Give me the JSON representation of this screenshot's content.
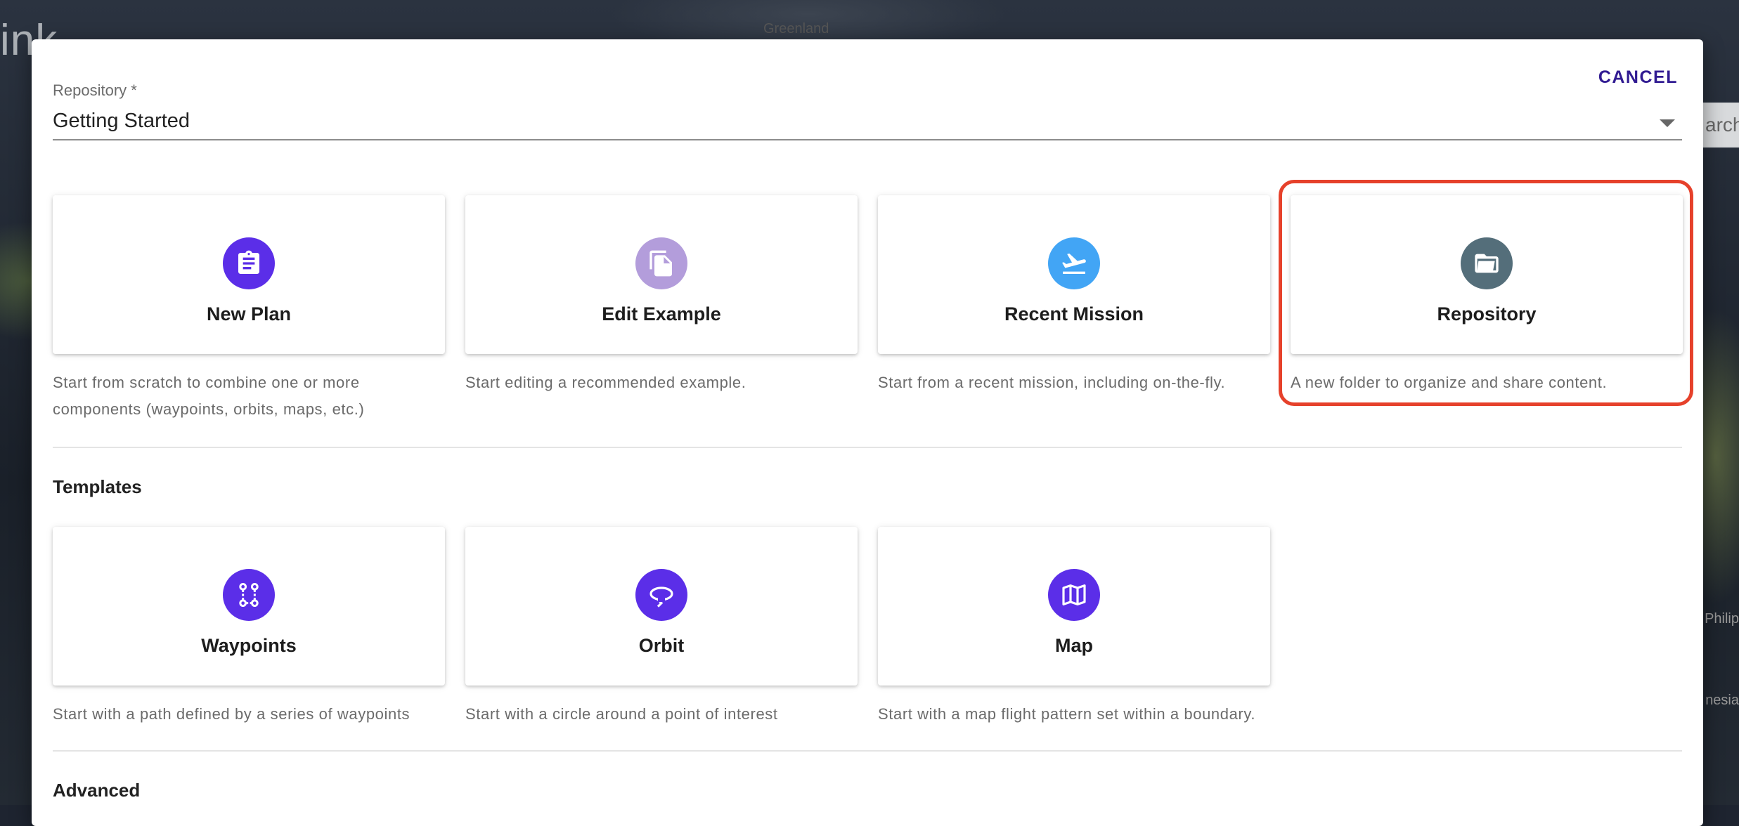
{
  "background": {
    "logo_text": "ink",
    "map_labels": [
      "Greenland",
      "Philip",
      "nesia"
    ],
    "search_text": "arch"
  },
  "dialog": {
    "cancel_label": "CANCEL",
    "repository": {
      "label": "Repository *",
      "value": "Getting Started"
    },
    "start_options": [
      {
        "title": "New Plan",
        "description": "Start from scratch to combine one or more components (waypoints, orbits, maps, etc.)",
        "icon": "clipboard-icon",
        "color": "#5b2ee8"
      },
      {
        "title": "Edit Example",
        "description": "Start editing a recommended example.",
        "icon": "copy-icon",
        "color": "#b39ddb"
      },
      {
        "title": "Recent Mission",
        "description": "Start from a recent mission, including on-the-fly.",
        "icon": "flight-takeoff-icon",
        "color": "#42a5f5"
      },
      {
        "title": "Repository",
        "description": "A new folder to organize and share content.",
        "icon": "folder-open-icon",
        "color": "#546e7a"
      }
    ],
    "templates_title": "Templates",
    "templates": [
      {
        "title": "Waypoints",
        "description": "Start with a path defined by a series of waypoints",
        "icon": "waypoints-icon",
        "color": "#5b2ee8"
      },
      {
        "title": "Orbit",
        "description": "Start with a circle around a point of interest",
        "icon": "orbit-icon",
        "color": "#5b2ee8"
      },
      {
        "title": "Map",
        "description": "Start with a map flight pattern set within a boundary.",
        "icon": "map-icon",
        "color": "#5b2ee8"
      }
    ],
    "advanced_title": "Advanced",
    "highlight_color": "#e6412b"
  }
}
